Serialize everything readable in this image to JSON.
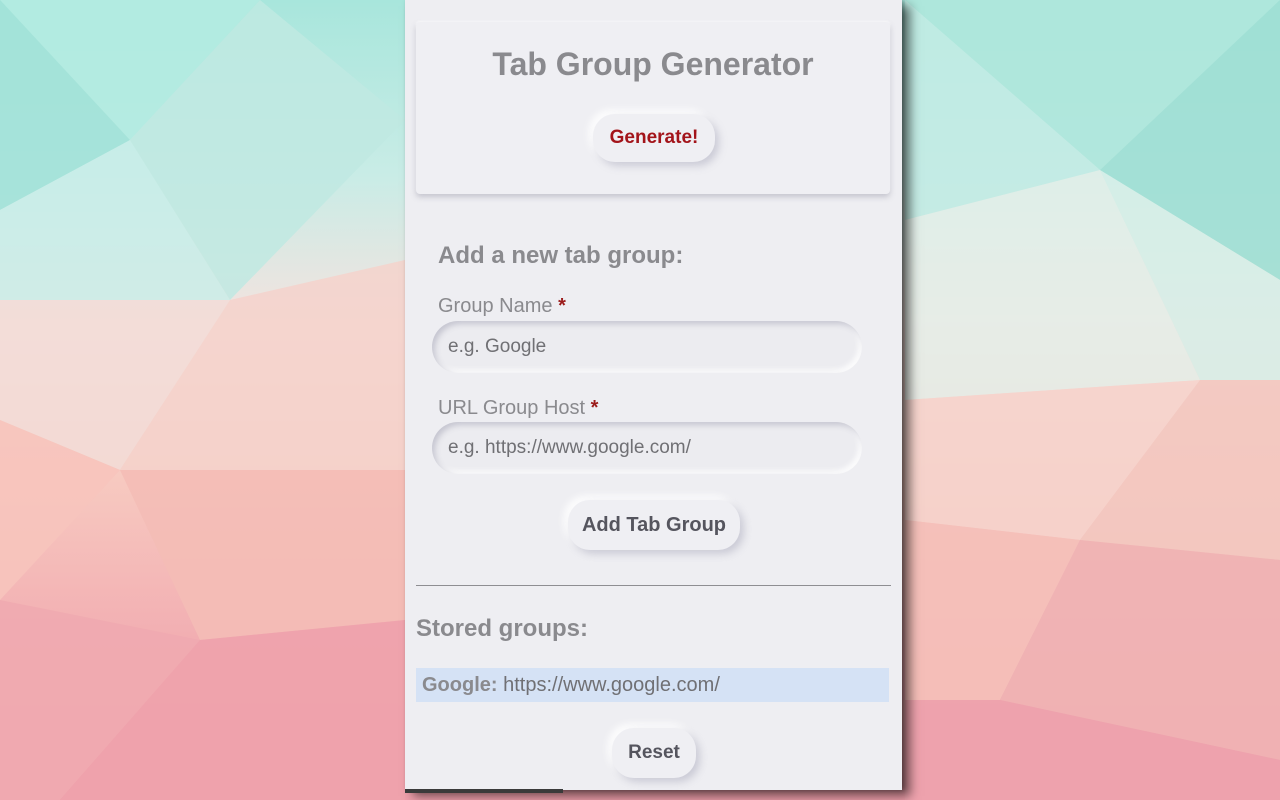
{
  "header": {
    "title": "Tab Group Generator",
    "generate_label": "Generate!"
  },
  "add_form": {
    "heading": "Add a new tab group:",
    "group_name_label": "Group Name",
    "group_name_placeholder": "e.g. Google",
    "url_label": "URL Group Host",
    "url_placeholder": "e.g. https://www.google.com/",
    "required_marker": "*",
    "add_label": "Add Tab Group"
  },
  "stored": {
    "heading": "Stored groups:",
    "groups": [
      {
        "name": "Google:",
        "url": "https://www.google.com/"
      }
    ],
    "reset_label": "Reset"
  },
  "colors": {
    "accent_red": "#a3141a",
    "required_red": "#9b1b1b",
    "panel_bg": "#eeeef2",
    "highlight_row": "#d5e2f5"
  }
}
